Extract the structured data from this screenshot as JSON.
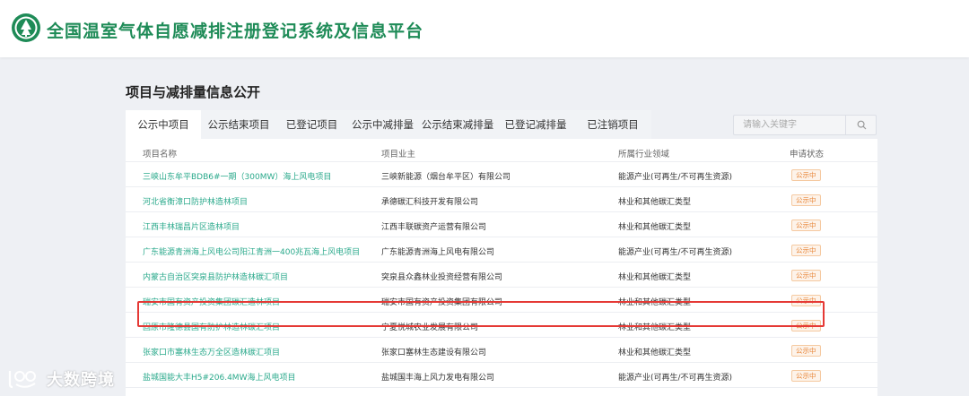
{
  "header": {
    "site_title": "全国温室气体自愿减排注册登记系统及信息平台",
    "brand_color": "#1e8b57"
  },
  "section": {
    "title": "项目与减排量信息公开"
  },
  "tabs": [
    {
      "label": "公示中项目",
      "active": true
    },
    {
      "label": "公示结束项目",
      "active": false
    },
    {
      "label": "已登记项目",
      "active": false
    },
    {
      "label": "公示中减排量",
      "active": false
    },
    {
      "label": "公示结束减排量",
      "active": false
    },
    {
      "label": "已登记减排量",
      "active": false
    },
    {
      "label": "已注销项目",
      "active": false
    }
  ],
  "search": {
    "placeholder": "请输入关键字",
    "icon": "search-icon"
  },
  "table": {
    "headers": [
      "项目名称",
      "项目业主",
      "所属行业领域",
      "申请状态"
    ],
    "rows": [
      {
        "name": "三峡山东牟平BDB6#一期（300MW）海上风电项目",
        "owner": "三峡新能源（烟台牟平区）有限公司",
        "field": "能源产业(可再生/不可再生资源)",
        "status": "公示中"
      },
      {
        "name": "河北省衡漳口防护林造林项目",
        "owner": "承德碳汇科技开发有限公司",
        "field": "林业和其他碳汇类型",
        "status": "公示中"
      },
      {
        "name": "江西丰林瑞昌片区造林项目",
        "owner": "江西丰联碳资产运营有限公司",
        "field": "林业和其他碳汇类型",
        "status": "公示中"
      },
      {
        "name": "广东能源青洲海上风电公司阳江青洲一400兆瓦海上风电项目",
        "owner": "广东能源青洲海上风电有限公司",
        "field": "能源产业(可再生/不可再生资源)",
        "status": "公示中"
      },
      {
        "name": "内蒙古自治区突泉县防护林造林碳汇项目",
        "owner": "突泉县众鑫林业投资经营有限公司",
        "field": "林业和其他碳汇类型",
        "status": "公示中"
      },
      {
        "name": "瑞安市国有资产投资集团碳汇造林项目",
        "owner": "瑞安市国有资产投资集团有限公司",
        "field": "林业和其他碳汇类型",
        "status": "公示中"
      },
      {
        "name": "固原市隆德县国有防护林造林碳汇项目",
        "owner": "宁夏悦城农业发展有限公司",
        "field": "林业和其他碳汇类型",
        "status": "公示中"
      },
      {
        "name": "张家口市塞林生态万全区造林碳汇项目",
        "owner": "张家口塞林生态建设有限公司",
        "field": "林业和其他碳汇类型",
        "status": "公示中"
      },
      {
        "name": "盐城国能大丰H5#206.4MW海上风电项目",
        "owner": "盐城国丰海上风力发电有限公司",
        "field": "能源产业(可再生/不可再生资源)",
        "status": "公示中"
      }
    ]
  },
  "watermark": {
    "text": "大数跨境"
  },
  "colors": {
    "link": "#2aa98b",
    "badge": "#e8873a",
    "highlight": "#e53935"
  }
}
